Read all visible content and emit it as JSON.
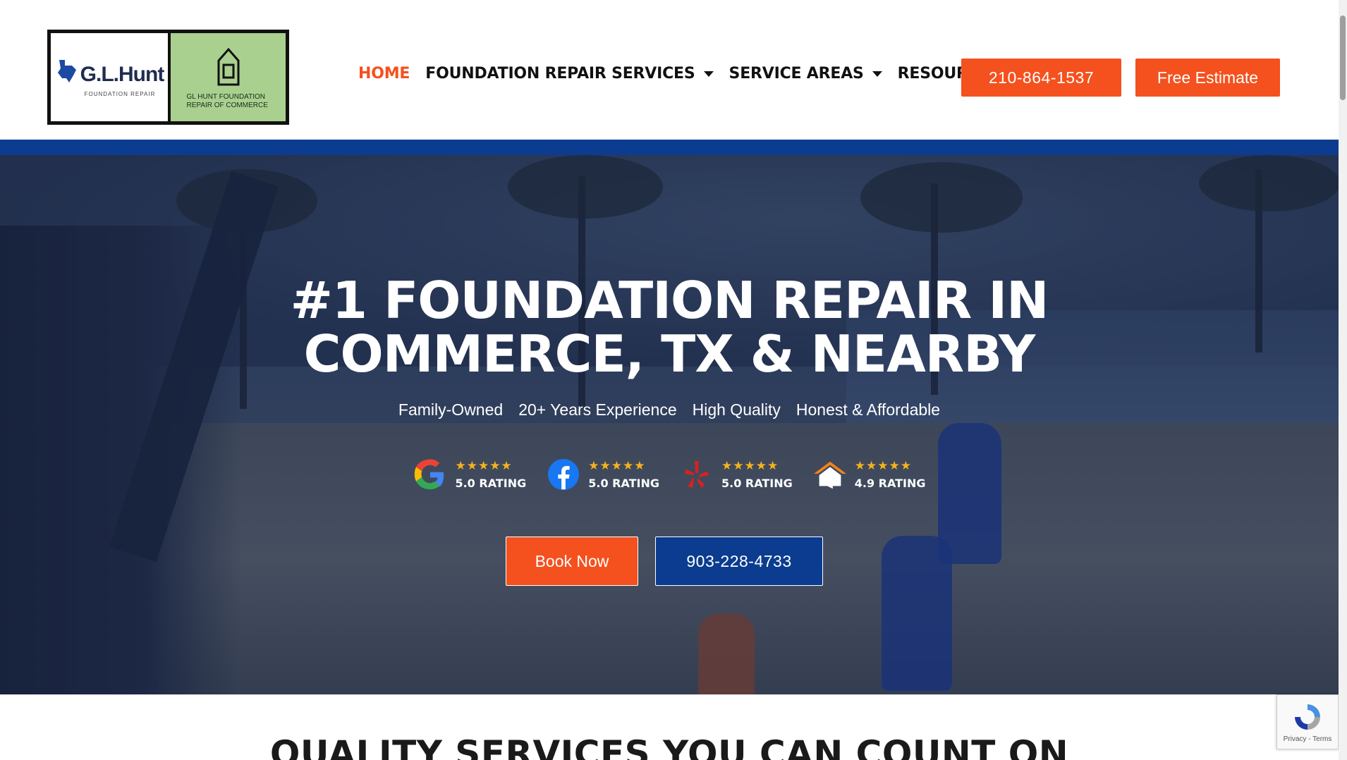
{
  "logo": {
    "brand_mark": "TX",
    "brand_name": "G.L.Hunt",
    "brand_sub": "FOUNDATION REPAIR",
    "commerce_text": "GL HUNT FOUNDATION REPAIR OF COMMERCE"
  },
  "nav": {
    "items": [
      {
        "label": "HOME",
        "active": true,
        "has_dropdown": false
      },
      {
        "label": "FOUNDATION REPAIR SERVICES",
        "active": false,
        "has_dropdown": true
      },
      {
        "label": "SERVICE AREAS",
        "active": false,
        "has_dropdown": true
      },
      {
        "label": "RESOURCES",
        "active": false,
        "has_dropdown": true
      }
    ]
  },
  "header_buttons": {
    "phone": "210-864-1537",
    "estimate": "Free Estimate"
  },
  "hero": {
    "title_line1": "#1 FOUNDATION REPAIR IN",
    "title_line2": "COMMERCE, TX & NEARBY",
    "taglines": [
      "Family-Owned",
      "20+ Years Experience",
      "High Quality",
      "Honest & Affordable"
    ],
    "ratings": [
      {
        "source": "google-icon",
        "stars": "★★★★★",
        "label": "5.0 RATING"
      },
      {
        "source": "facebook-icon",
        "stars": "★★★★★",
        "label": "5.0 RATING"
      },
      {
        "source": "yelp-icon",
        "stars": "★★★★★",
        "label": "5.0 RATING"
      },
      {
        "source": "homeadvisor-icon",
        "stars": "★★★★★",
        "label": "4.9 RATING"
      }
    ],
    "book_button": "Book Now",
    "call_button": "903-228-4733"
  },
  "section": {
    "title": "QUALITY SERVICES YOU CAN COUNT ON"
  },
  "recaptcha": {
    "text": "Privacy - Terms"
  },
  "colors": {
    "accent": "#f4511e",
    "navy": "#0b3c8f",
    "star": "#f6b21b",
    "logo_green": "#a9d08e"
  }
}
